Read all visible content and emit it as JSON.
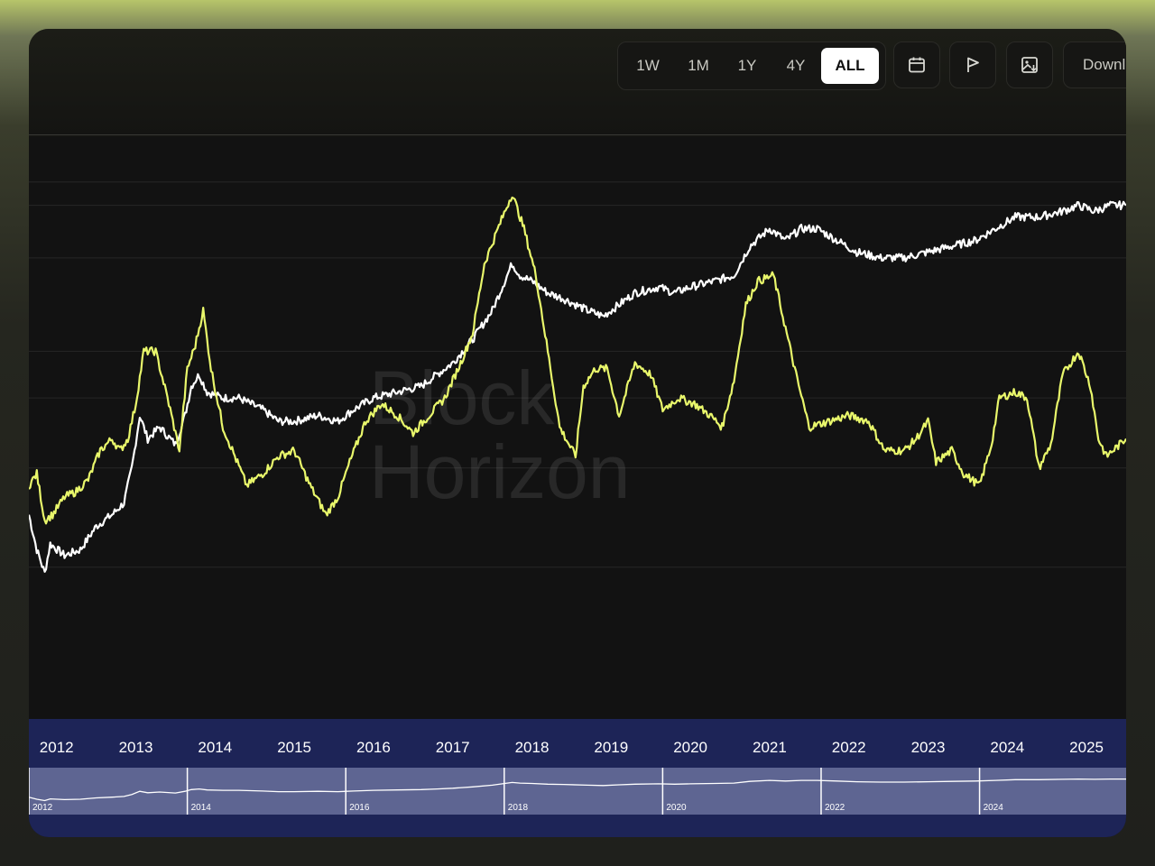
{
  "toolbar": {
    "ranges": [
      "1W",
      "1M",
      "1Y",
      "4Y",
      "ALL"
    ],
    "active_range": "ALL",
    "download_label": "Download",
    "icons": [
      "calendar-icon",
      "flag-icon",
      "image-download-icon"
    ]
  },
  "watermark": {
    "line1": "Block",
    "line2": "Horizon"
  },
  "colors": {
    "accent_series": "#e9f76b",
    "white_series": "#ffffff",
    "navigator": "#1d2457",
    "navigator_window": "#5e6592"
  },
  "chart_data": {
    "type": "line",
    "x_range": [
      2011.85,
      2025.7
    ],
    "grid": true,
    "legend": "none",
    "series": [
      {
        "color": "#ffffff",
        "points": [
          [
            2011.85,
            0.35
          ],
          [
            2011.95,
            0.29
          ],
          [
            2012.05,
            0.25
          ],
          [
            2012.12,
            0.3
          ],
          [
            2012.3,
            0.28
          ],
          [
            2012.5,
            0.29
          ],
          [
            2012.7,
            0.33
          ],
          [
            2012.9,
            0.35
          ],
          [
            2013.05,
            0.37
          ],
          [
            2013.15,
            0.43
          ],
          [
            2013.25,
            0.52
          ],
          [
            2013.35,
            0.48
          ],
          [
            2013.5,
            0.5
          ],
          [
            2013.7,
            0.47
          ],
          [
            2013.82,
            0.52
          ],
          [
            2013.9,
            0.57
          ],
          [
            2014.0,
            0.59
          ],
          [
            2014.1,
            0.56
          ],
          [
            2014.3,
            0.55
          ],
          [
            2014.5,
            0.55
          ],
          [
            2014.8,
            0.53
          ],
          [
            2015.0,
            0.51
          ],
          [
            2015.2,
            0.51
          ],
          [
            2015.5,
            0.52
          ],
          [
            2015.75,
            0.51
          ],
          [
            2015.95,
            0.53
          ],
          [
            2016.2,
            0.55
          ],
          [
            2016.5,
            0.56
          ],
          [
            2016.8,
            0.57
          ],
          [
            2017.0,
            0.59
          ],
          [
            2017.2,
            0.61
          ],
          [
            2017.45,
            0.65
          ],
          [
            2017.7,
            0.7
          ],
          [
            2017.95,
            0.78
          ],
          [
            2018.05,
            0.76
          ],
          [
            2018.2,
            0.75
          ],
          [
            2018.4,
            0.73
          ],
          [
            2018.6,
            0.72
          ],
          [
            2018.9,
            0.7
          ],
          [
            2019.1,
            0.69
          ],
          [
            2019.3,
            0.71
          ],
          [
            2019.5,
            0.73
          ],
          [
            2019.8,
            0.74
          ],
          [
            2020.0,
            0.73
          ],
          [
            2020.2,
            0.74
          ],
          [
            2020.5,
            0.75
          ],
          [
            2020.75,
            0.76
          ],
          [
            2020.95,
            0.81
          ],
          [
            2021.2,
            0.84
          ],
          [
            2021.4,
            0.82
          ],
          [
            2021.6,
            0.84
          ],
          [
            2021.8,
            0.84
          ],
          [
            2022.05,
            0.82
          ],
          [
            2022.3,
            0.8
          ],
          [
            2022.6,
            0.79
          ],
          [
            2022.9,
            0.79
          ],
          [
            2023.2,
            0.8
          ],
          [
            2023.5,
            0.81
          ],
          [
            2023.8,
            0.82
          ],
          [
            2024.05,
            0.84
          ],
          [
            2024.3,
            0.86
          ],
          [
            2024.6,
            0.86
          ],
          [
            2024.9,
            0.87
          ],
          [
            2025.1,
            0.88
          ],
          [
            2025.3,
            0.87
          ],
          [
            2025.5,
            0.88
          ],
          [
            2025.7,
            0.88
          ]
        ]
      },
      {
        "color": "#e9f76b",
        "points": [
          [
            2011.85,
            0.4
          ],
          [
            2011.95,
            0.42
          ],
          [
            2012.05,
            0.34
          ],
          [
            2012.15,
            0.35
          ],
          [
            2012.3,
            0.38
          ],
          [
            2012.45,
            0.39
          ],
          [
            2012.6,
            0.41
          ],
          [
            2012.75,
            0.46
          ],
          [
            2012.9,
            0.48
          ],
          [
            2013.0,
            0.46
          ],
          [
            2013.1,
            0.48
          ],
          [
            2013.2,
            0.54
          ],
          [
            2013.3,
            0.63
          ],
          [
            2013.45,
            0.63
          ],
          [
            2013.6,
            0.55
          ],
          [
            2013.75,
            0.46
          ],
          [
            2013.85,
            0.6
          ],
          [
            2013.95,
            0.64
          ],
          [
            2014.05,
            0.7
          ],
          [
            2014.15,
            0.6
          ],
          [
            2014.3,
            0.5
          ],
          [
            2014.45,
            0.45
          ],
          [
            2014.6,
            0.4
          ],
          [
            2014.8,
            0.42
          ],
          [
            2015.0,
            0.45
          ],
          [
            2015.2,
            0.46
          ],
          [
            2015.4,
            0.4
          ],
          [
            2015.6,
            0.35
          ],
          [
            2015.75,
            0.38
          ],
          [
            2015.9,
            0.44
          ],
          [
            2016.1,
            0.51
          ],
          [
            2016.3,
            0.54
          ],
          [
            2016.5,
            0.52
          ],
          [
            2016.7,
            0.49
          ],
          [
            2016.9,
            0.52
          ],
          [
            2017.1,
            0.55
          ],
          [
            2017.3,
            0.61
          ],
          [
            2017.45,
            0.66
          ],
          [
            2017.6,
            0.78
          ],
          [
            2017.8,
            0.85
          ],
          [
            2017.95,
            0.9
          ],
          [
            2018.1,
            0.84
          ],
          [
            2018.25,
            0.76
          ],
          [
            2018.4,
            0.63
          ],
          [
            2018.55,
            0.5
          ],
          [
            2018.75,
            0.45
          ],
          [
            2018.85,
            0.57
          ],
          [
            2019.0,
            0.6
          ],
          [
            2019.15,
            0.6
          ],
          [
            2019.3,
            0.52
          ],
          [
            2019.5,
            0.61
          ],
          [
            2019.7,
            0.59
          ],
          [
            2019.85,
            0.53
          ],
          [
            2020.05,
            0.55
          ],
          [
            2020.25,
            0.54
          ],
          [
            2020.45,
            0.52
          ],
          [
            2020.6,
            0.5
          ],
          [
            2020.75,
            0.58
          ],
          [
            2020.9,
            0.71
          ],
          [
            2021.05,
            0.75
          ],
          [
            2021.25,
            0.76
          ],
          [
            2021.4,
            0.67
          ],
          [
            2021.55,
            0.58
          ],
          [
            2021.7,
            0.5
          ],
          [
            2021.95,
            0.51
          ],
          [
            2022.2,
            0.52
          ],
          [
            2022.45,
            0.51
          ],
          [
            2022.65,
            0.46
          ],
          [
            2022.9,
            0.46
          ],
          [
            2023.05,
            0.48
          ],
          [
            2023.2,
            0.51
          ],
          [
            2023.3,
            0.44
          ],
          [
            2023.5,
            0.46
          ],
          [
            2023.65,
            0.42
          ],
          [
            2023.85,
            0.4
          ],
          [
            2024.0,
            0.47
          ],
          [
            2024.1,
            0.55
          ],
          [
            2024.3,
            0.56
          ],
          [
            2024.45,
            0.55
          ],
          [
            2024.6,
            0.43
          ],
          [
            2024.75,
            0.47
          ],
          [
            2024.9,
            0.59
          ],
          [
            2025.1,
            0.63
          ],
          [
            2025.25,
            0.57
          ],
          [
            2025.35,
            0.48
          ],
          [
            2025.45,
            0.45
          ],
          [
            2025.7,
            0.48
          ]
        ]
      }
    ],
    "navigator": {
      "year_labels": [
        "2012",
        "2013",
        "2014",
        "2015",
        "2016",
        "2017",
        "2018",
        "2019",
        "2020",
        "2021",
        "2022",
        "2023",
        "2024",
        "2025"
      ],
      "minor_labels": [
        "2012",
        "2014",
        "2016",
        "2018",
        "2020",
        "2022",
        "2024"
      ]
    }
  }
}
